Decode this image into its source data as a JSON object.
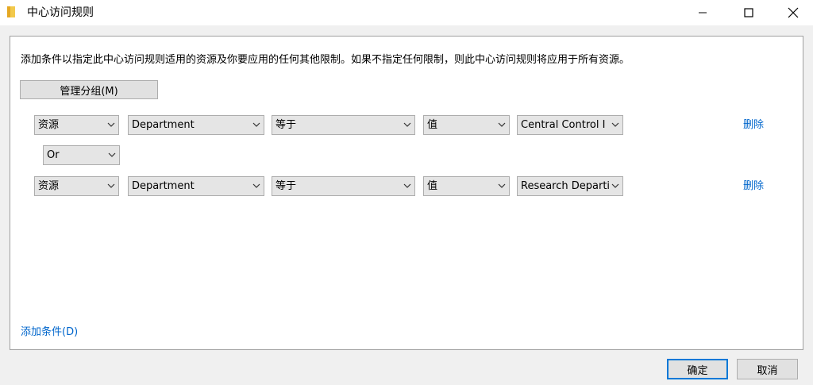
{
  "window": {
    "title": "中心访问规则"
  },
  "instruction": "添加条件以指定此中心访问规则适用的资源及你要应用的任何其他限制。如果不指定任何限制，则此中心访问规则将应用于所有资源。",
  "manage_group_label": "管理分组(M)",
  "conditions": [
    {
      "target": "资源",
      "attribute": "Department",
      "operator": "等于",
      "value_type": "值",
      "value": "Central Control I",
      "delete_label": "删除"
    },
    {
      "target": "资源",
      "attribute": "Department",
      "operator": "等于",
      "value_type": "值",
      "value": "Research Departi",
      "delete_label": "删除"
    }
  ],
  "connector": "Or",
  "add_condition_label": "添加条件(D)",
  "buttons": {
    "ok": "确定",
    "cancel": "取消"
  },
  "colors": {
    "link": "#0066cc",
    "accent": "#0078d7",
    "folder": "#f2c94c"
  }
}
